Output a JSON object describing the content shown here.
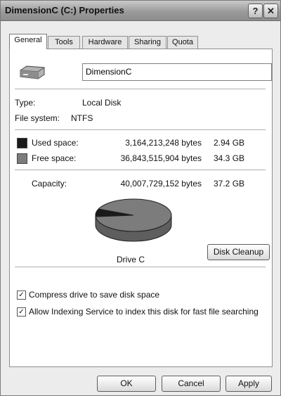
{
  "window": {
    "title": "DimensionC (C:) Properties",
    "help_label": "?",
    "close_label": "✕"
  },
  "tabs": [
    {
      "label": "General",
      "active": true
    },
    {
      "label": "Tools",
      "active": false
    },
    {
      "label": "Hardware",
      "active": false
    },
    {
      "label": "Sharing",
      "active": false
    },
    {
      "label": "Quota",
      "active": false
    }
  ],
  "general": {
    "drive_icon": "hard-drive-icon",
    "drive_name_value": "DimensionC",
    "type_label": "Type:",
    "type_value": "Local Disk",
    "filesystem_label": "File system:",
    "filesystem_value": "NTFS",
    "used": {
      "label": "Used space:",
      "bytes": "3,164,213,248 bytes",
      "size": "2.94 GB",
      "color": "#1a1a1a"
    },
    "free": {
      "label": "Free space:",
      "bytes": "36,843,515,904 bytes",
      "size": "34.3 GB",
      "color": "#7c7c7c"
    },
    "capacity": {
      "label": "Capacity:",
      "bytes": "40,007,729,152 bytes",
      "size": "37.2 GB"
    },
    "pie": {
      "used_fraction": 0.079,
      "caption": "Drive C"
    },
    "cleanup_label": "Disk Cleanup",
    "compress": {
      "label": "Compress drive to save disk space",
      "checked": true
    },
    "indexing": {
      "label": "Allow Indexing Service to index this disk for fast file searching",
      "checked": true
    }
  },
  "footer": {
    "ok": "OK",
    "cancel": "Cancel",
    "apply": "Apply"
  }
}
